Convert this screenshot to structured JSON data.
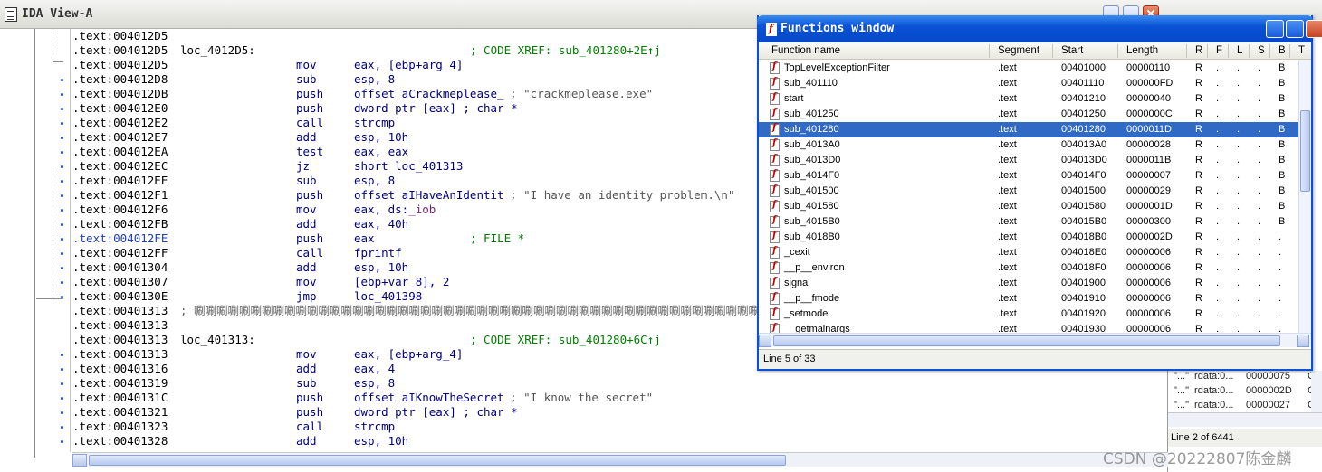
{
  "ida_view": {
    "title": "IDA View-A",
    "lines": [
      {
        "addr": ".text:004012D5"
      },
      {
        "addr": ".text:004012D5",
        "label": "loc_4012D5:",
        "comment": "; CODE XREF: sub_401280+2E↑j"
      },
      {
        "addr": ".text:004012D5",
        "mnem": "mov",
        "ops": "eax, [ebp+arg_4]"
      },
      {
        "addr": ".text:004012D8",
        "mnem": "sub",
        "ops": "esp, 8"
      },
      {
        "addr": ".text:004012DB",
        "mnem": "push",
        "ops": "offset aCrackmeplease_",
        "str": "; \"crackmeplease.exe\""
      },
      {
        "addr": ".text:004012E0",
        "mnem": "push",
        "ops": "dword ptr [eax] ; char *"
      },
      {
        "addr": ".text:004012E2",
        "mnem": "call",
        "ops": "strcmp"
      },
      {
        "addr": ".text:004012E7",
        "mnem": "add",
        "ops": "esp, 10h"
      },
      {
        "addr": ".text:004012EA",
        "mnem": "test",
        "ops": "eax, eax"
      },
      {
        "addr": ".text:004012EC",
        "mnem": "jz",
        "ops": "short loc_401313"
      },
      {
        "addr": ".text:004012EE",
        "mnem": "sub",
        "ops": "esp, 8"
      },
      {
        "addr": ".text:004012F1",
        "mnem": "push",
        "ops": "offset aIHaveAnIdentit",
        "str": "; \"I have an identity problem.\\n\""
      },
      {
        "addr": ".text:004012F6",
        "mnem": "mov",
        "ops": "eax, ds:_iob"
      },
      {
        "addr": ".text:004012FB",
        "mnem": "add",
        "ops": "eax, 40h"
      },
      {
        "addr": ".text:004012FE",
        "mnem": "push",
        "ops": "eax",
        "comment": "; FILE *",
        "selected": true
      },
      {
        "addr": ".text:004012FF",
        "mnem": "call",
        "ops": "fprintf"
      },
      {
        "addr": ".text:00401304",
        "mnem": "add",
        "ops": "esp, 10h"
      },
      {
        "addr": ".text:00401307",
        "mnem": "mov",
        "ops": "[ebp+var_8], 2"
      },
      {
        "addr": ".text:0040130E",
        "mnem": "jmp",
        "ops": "loc_401398"
      },
      {
        "addr": ".text:00401313",
        "garbage": "; 唰唰唰唰唰唰唰唰唰唰唰唰唰唰唰唰唰唰唰唰唰唰唰唰唰唰唰唰唰唰唰唰唰唰唰唰唰唰唰唰唰唰唰唰唰唰唰唰唰唰唰唰唰唰唰唰唰唰唰唰唰唰唰唰唰唰唰唰⊘"
      },
      {
        "addr": ".text:00401313"
      },
      {
        "addr": ".text:00401313",
        "label": "loc_401313:",
        "comment": "; CODE XREF: sub_401280+6C↑j"
      },
      {
        "addr": ".text:00401313",
        "mnem": "mov",
        "ops": "eax, [ebp+arg_4]"
      },
      {
        "addr": ".text:00401316",
        "mnem": "add",
        "ops": "eax, 4"
      },
      {
        "addr": ".text:00401319",
        "mnem": "sub",
        "ops": "esp, 8"
      },
      {
        "addr": ".text:0040131C",
        "mnem": "push",
        "ops": "offset aIKnowTheSecret",
        "str": "; \"I know the secret\""
      },
      {
        "addr": ".text:00401321",
        "mnem": "push",
        "ops": "dword ptr [eax] ; char *"
      },
      {
        "addr": ".text:00401323",
        "mnem": "call",
        "ops": "strcmp"
      },
      {
        "addr": ".text:00401328",
        "mnem": "add",
        "ops": "esp, 10h"
      }
    ]
  },
  "functions_window": {
    "title": "Functions window",
    "columns": [
      "Function name",
      "Segment",
      "Start",
      "Length",
      "R",
      "F",
      "L",
      "S",
      "B",
      "T"
    ],
    "rows": [
      {
        "name": "TopLevelExceptionFilter",
        "segment": ".text",
        "start": "00401000",
        "length": "00000110",
        "R": "R",
        "F": ".",
        "L": ".",
        "S": ".",
        "B": "B",
        "T": "T"
      },
      {
        "name": "sub_401110",
        "segment": ".text",
        "start": "00401110",
        "length": "000000FD",
        "R": "R",
        "F": ".",
        "L": ".",
        "S": ".",
        "B": "B",
        "T": "."
      },
      {
        "name": "start",
        "segment": ".text",
        "start": "00401210",
        "length": "00000040",
        "R": "R",
        "F": ".",
        "L": ".",
        "S": ".",
        "B": "B",
        "T": "."
      },
      {
        "name": "sub_401250",
        "segment": ".text",
        "start": "00401250",
        "length": "0000000C",
        "R": "R",
        "F": ".",
        "L": ".",
        "S": ".",
        "B": "B",
        "T": "."
      },
      {
        "name": "sub_401280",
        "segment": ".text",
        "start": "00401280",
        "length": "0000011D",
        "R": "R",
        "F": ".",
        "L": ".",
        "S": ".",
        "B": "B",
        "T": ".",
        "selected": true
      },
      {
        "name": "sub_4013A0",
        "segment": ".text",
        "start": "004013A0",
        "length": "00000028",
        "R": "R",
        "F": ".",
        "L": ".",
        "S": ".",
        "B": "B",
        "T": "."
      },
      {
        "name": "sub_4013D0",
        "segment": ".text",
        "start": "004013D0",
        "length": "0000011B",
        "R": "R",
        "F": ".",
        "L": ".",
        "S": ".",
        "B": "B",
        "T": "."
      },
      {
        "name": "sub_4014F0",
        "segment": ".text",
        "start": "004014F0",
        "length": "00000007",
        "R": "R",
        "F": ".",
        "L": ".",
        "S": ".",
        "B": "B",
        "T": "."
      },
      {
        "name": "sub_401500",
        "segment": ".text",
        "start": "00401500",
        "length": "00000029",
        "R": "R",
        "F": ".",
        "L": ".",
        "S": ".",
        "B": "B",
        "T": "."
      },
      {
        "name": "sub_401580",
        "segment": ".text",
        "start": "00401580",
        "length": "0000001D",
        "R": "R",
        "F": ".",
        "L": ".",
        "S": ".",
        "B": "B",
        "T": "."
      },
      {
        "name": "sub_4015B0",
        "segment": ".text",
        "start": "004015B0",
        "length": "00000300",
        "R": "R",
        "F": ".",
        "L": ".",
        "S": ".",
        "B": "B",
        "T": "."
      },
      {
        "name": "sub_4018B0",
        "segment": ".text",
        "start": "004018B0",
        "length": "0000002D",
        "R": "R",
        "F": ".",
        "L": ".",
        "S": ".",
        "B": ".",
        "T": "."
      },
      {
        "name": "_cexit",
        "segment": ".text",
        "start": "004018E0",
        "length": "00000006",
        "R": "R",
        "F": ".",
        "L": ".",
        "S": ".",
        "B": ".",
        "T": "T"
      },
      {
        "name": "__p__environ",
        "segment": ".text",
        "start": "004018F0",
        "length": "00000006",
        "R": "R",
        "F": ".",
        "L": ".",
        "S": ".",
        "B": ".",
        "T": "."
      },
      {
        "name": "signal",
        "segment": ".text",
        "start": "00401900",
        "length": "00000006",
        "R": "R",
        "F": ".",
        "L": ".",
        "S": ".",
        "B": ".",
        "T": "T"
      },
      {
        "name": "__p__fmode",
        "segment": ".text",
        "start": "00401910",
        "length": "00000006",
        "R": "R",
        "F": ".",
        "L": ".",
        "S": ".",
        "B": ".",
        "T": "."
      },
      {
        "name": "_setmode",
        "segment": ".text",
        "start": "00401920",
        "length": "00000006",
        "R": "R",
        "F": ".",
        "L": ".",
        "S": ".",
        "B": ".",
        "T": "T"
      },
      {
        "name": "__getmainargs",
        "segment": ".text",
        "start": "00401930",
        "length": "00000006",
        "R": "R",
        "F": ".",
        "L": ".",
        "S": ".",
        "B": ".",
        "T": "."
      }
    ],
    "status": "Line 5 of 33"
  },
  "names_window": {
    "rows": [
      {
        "c1": "\"...\"",
        "c2": ".rdata:0...",
        "c3": "00000075",
        "c4": "C"
      },
      {
        "c1": "\"...\"",
        "c2": ".rdata:0...",
        "c3": "0000002D",
        "c4": "C"
      },
      {
        "c1": "\"...\"",
        "c2": ".rdata:0...",
        "c3": "00000027",
        "c4": "C"
      }
    ],
    "status": "Line 2 of 6441"
  },
  "watermark": "CSDN @20222807陈金麟",
  "colors": {
    "selection": "#316ac5",
    "title_blue": "#0a52d6",
    "code_blue": "#000080",
    "comment_green": "#007f00"
  }
}
